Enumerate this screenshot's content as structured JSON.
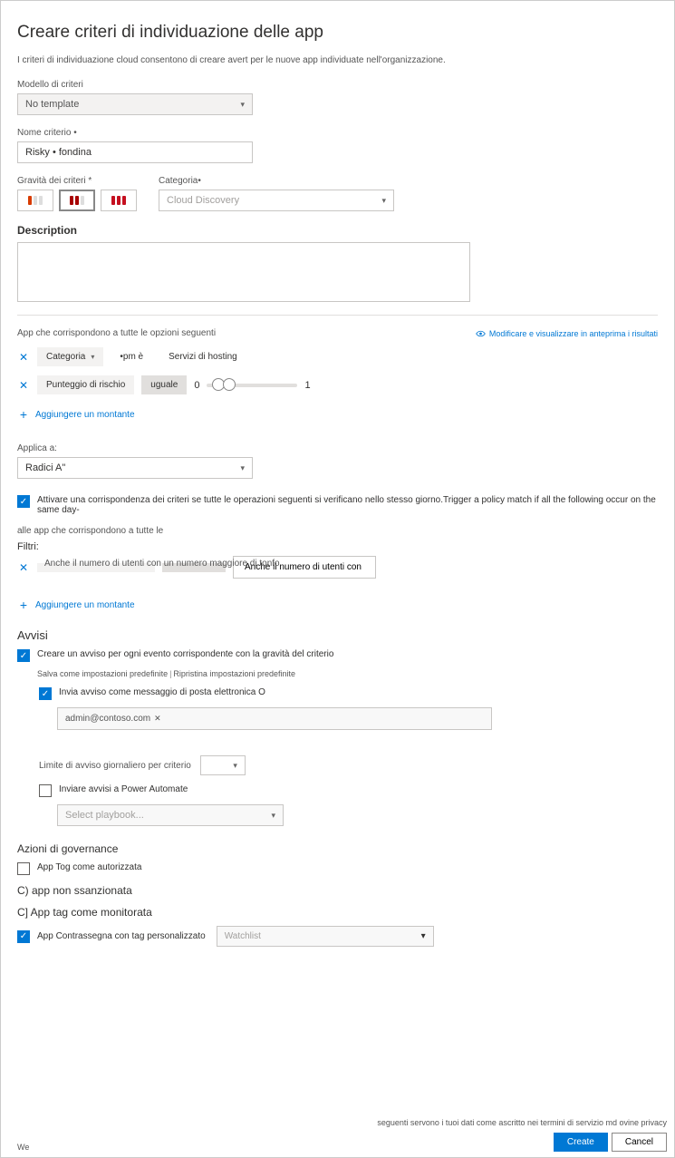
{
  "title": "Creare criteri di individuazione delle app",
  "subtitle": "I criteri di individuazione cloud consentono di creare avert per le nuove app individuate nell'organizzazione.",
  "template": {
    "label": "Modello di criteri",
    "value": "No template"
  },
  "policyName": {
    "label": "Nome criterio •",
    "value": "Risky • fondina"
  },
  "severity": {
    "label": "Gravità dei criteri *"
  },
  "category": {
    "label": "Categoria•",
    "value": "Cloud Discovery"
  },
  "description": {
    "label": "Description",
    "value": ""
  },
  "appsSection": {
    "label": "App che corrispondono a tutte le opzioni seguenti",
    "editLink": "Modificare e visualizzare in anteprima i risultati"
  },
  "filter1": {
    "a": "Categoria",
    "b": "•pm è",
    "c": "Servizi di hosting"
  },
  "filter2": {
    "a": "Punteggio di rischio",
    "b": "uguale",
    "low": "0",
    "high": "1"
  },
  "addFilter": "Aggiungere un montante",
  "applyTo": {
    "label": "Applica a:",
    "value": "Radici A\""
  },
  "triggerCheck": "Attivare una corrispondenza dei criteri se tutte le operazioni seguenti si verificano nello stesso giorno.Trigger a policy match if all the following occur on the same day-",
  "filtersHeader": "alle app che corrispondono a tutte le",
  "filtersLabel": "Filtri:",
  "filter3": {
    "text": "Anche il numero di utenti con un numero maggiore di tonfo"
  },
  "alerts": {
    "header": "Avvisi",
    "create": "Creare un avviso per ogni evento corrispondente con la gravità del criterio",
    "saveDefault": "Salva come impostazioni predefinite",
    "restoreDefault": "Ripristina impostazioni predefinite",
    "emailCheck": "Invia avviso come messaggio di posta elettronica O",
    "email": "admin@contoso.com",
    "dailyLimit": "Limite di avviso giornaliero per criterio",
    "powerAutomate": "Inviare avvisi a Power Automate",
    "playbookPlaceholder": "Select playbook..."
  },
  "governance": {
    "header": "Azioni di governance",
    "authorized": "App Tog come autorizzata",
    "unsanctioned": "C) app non ssanzionata",
    "monitored": "C] App tag come monitorata",
    "customTag": "App Contrassegna con tag personalizzato",
    "tagValue": "Watchlist"
  },
  "footer": {
    "left": "We",
    "right": "seguenti servono i tuoi dati come ascritto nei termini di servizio md ovine privacy",
    "create": "Create",
    "cancel": "Cancel"
  }
}
